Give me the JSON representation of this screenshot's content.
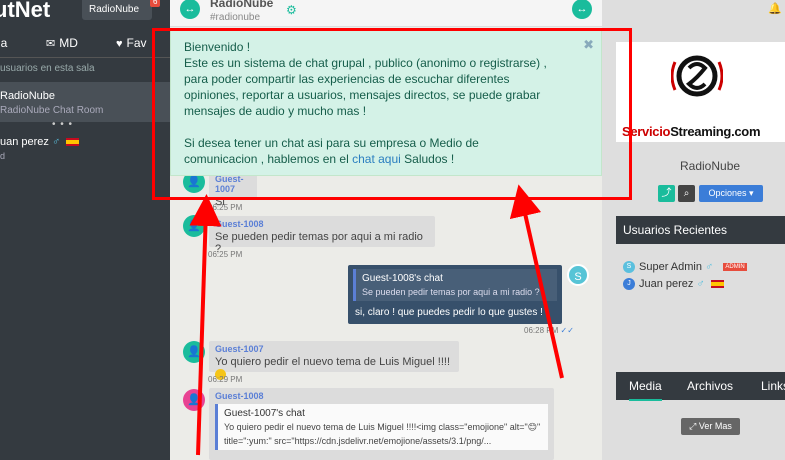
{
  "sidebar": {
    "brand": "utNet",
    "room_chip": "RadioNube",
    "chip_badge": "6",
    "tabs": [
      {
        "label": "la",
        "icon": "users-icon"
      },
      {
        "label": "MD",
        "icon": "envelope-icon"
      },
      {
        "label": "Fav",
        "icon": "heart-icon"
      }
    ],
    "search_placeholder": "usuarios en esta sala",
    "room": {
      "name": "RadioNube",
      "subtitle": "RadioNube Chat Room"
    },
    "typing_dots": "• • •",
    "user": {
      "name": "uan perez",
      "gender": "♂",
      "sub": "d"
    }
  },
  "header": {
    "title": "RadioNube",
    "tag": "#radionube",
    "left_btn": "↔",
    "right_btn": "↔"
  },
  "welcome": {
    "line1": "Bienvenido !",
    "line2": "Este es un sistema de chat grupal , publico (anonimo o registrarse) ,",
    "line3": "para poder compartir las experiencias de escuchar diferentes",
    "line4": "opiniones, reportar a usuarios, mensajes directos, se puede grabar",
    "line5": "mensajes de audio y mucho mas !",
    "line6": "Si desea tener un chat asi para su empresa o Medio de",
    "line7_a": "comunicacion , hablemos en el",
    "line7_link": "chat aqui",
    "line7_b": "Saludos !",
    "close": "✖"
  },
  "messages": [
    {
      "name": "Guest-1007",
      "text": "Si",
      "time": "06:25 PM"
    },
    {
      "name": "Guest-1008",
      "text": "Se pueden pedir temas por aqui a mi radio ?",
      "time": "06:25 PM"
    },
    {
      "quote_name": "Guest-1008's chat",
      "quote_text": "Se pueden pedir temas por aqui a mi radio ?",
      "text": "si, claro ! que puedes pedir lo que gustes !",
      "time": "06:28 PM",
      "avatar": "S"
    },
    {
      "name": "Guest-1007",
      "text": "Yo quiero pedir el nuevo tema de Luis Miguel !!!!",
      "time": "06:29 PM"
    },
    {
      "name": "Guest-1008",
      "quote_name": "Guest-1007's chat",
      "quote_line1": "Yo quiero pedir el nuevo tema de Luis Miguel !!!!<img class=\"emojione\" alt=\"😊\"",
      "quote_line2": "title=\":yum:\" src=\"https://cdn.jsdelivr.net/emojione/assets/3.1/png/..."
    }
  ],
  "right": {
    "logo_text_a": "Servicio",
    "logo_text_b": "Streaming",
    "logo_text_c": ".com",
    "room_label": "RadioNube",
    "options_label": "Opciones ▾",
    "recent_title": "Usuarios Recientes",
    "recent_users": [
      {
        "name": "Super Admin",
        "gender": "♂",
        "badge": "ADMIN",
        "initial": "S"
      },
      {
        "name": "Juan perez",
        "gender": "♂",
        "initial": "J"
      }
    ],
    "media_tabs": [
      "Media",
      "Archivos",
      "Links"
    ],
    "vermas_label": "Ver Mas"
  },
  "colors": {
    "accent": "#1abc9c",
    "sidebar": "#343a40",
    "highlight_frame": "#ff0000",
    "welcome_bg": "#d4f2e7"
  }
}
